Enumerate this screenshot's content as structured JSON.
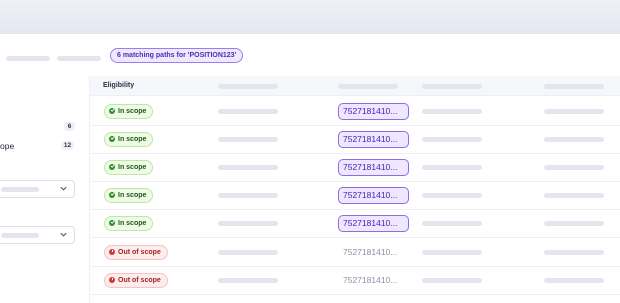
{
  "colors": {
    "accent": "#8b6ce6",
    "in_scope_bg": "#eefbe5",
    "in_scope_text": "#22571a",
    "out_scope_bg": "#fdecec",
    "out_scope_text": "#a3242a"
  },
  "toolbar": {
    "matching_paths": "6 matching paths for 'POSITION123'"
  },
  "sidebar": {
    "count_first": "6",
    "label_second": "ope",
    "count_second": "12",
    "select_icon": "chevron-down-icon"
  },
  "table": {
    "columns": [
      "Eligibility"
    ],
    "rows": [
      {
        "status": "In scope",
        "type": "in",
        "id": "7527181410...",
        "highlight": true
      },
      {
        "status": "In scope",
        "type": "in",
        "id": "7527181410...",
        "highlight": true
      },
      {
        "status": "In scope",
        "type": "in",
        "id": "7527181410...",
        "highlight": true
      },
      {
        "status": "In scope",
        "type": "in",
        "id": "7527181410...",
        "highlight": true
      },
      {
        "status": "In scope",
        "type": "in",
        "id": "7527181410...",
        "highlight": true
      },
      {
        "status": "Out of scope",
        "type": "out",
        "id": "7527181410...",
        "highlight": false
      },
      {
        "status": "Out of scope",
        "type": "out",
        "id": "7527181410...",
        "highlight": false
      }
    ]
  }
}
